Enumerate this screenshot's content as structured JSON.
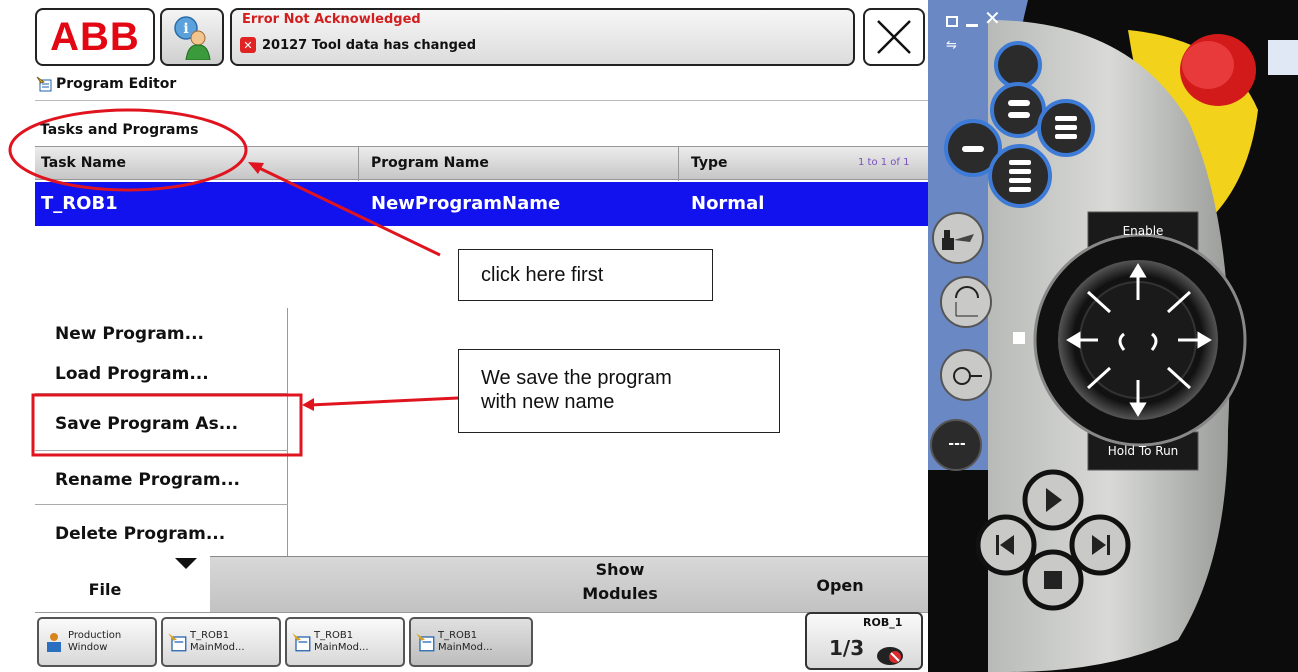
{
  "header": {
    "logo_text": "ABB",
    "status_title": "Error Not Acknowledged",
    "status_message": "20127 Tool data has changed",
    "close_symbol": "✕"
  },
  "editor": {
    "title": "Program Editor",
    "section_heading": "Tasks and Programs",
    "columns": [
      "Task Name",
      "Program Name",
      "Type"
    ],
    "page_count": "1 to 1 of 1",
    "rows": [
      {
        "task": "T_ROB1",
        "program": "NewProgramName",
        "type": "Normal"
      }
    ]
  },
  "file_menu": {
    "items": [
      "New Program...",
      "Load Program...",
      "Save Program As...",
      "Rename Program...",
      "Delete Program..."
    ]
  },
  "toolbar": {
    "file_label": "File",
    "show_modules_line1": "Show",
    "show_modules_line2": "Modules",
    "open_label": "Open"
  },
  "taskbar": {
    "items": [
      {
        "line1": "Production",
        "line2": "Window"
      },
      {
        "line1": "T_ROB1",
        "line2": "MainMod..."
      },
      {
        "line1": "T_ROB1",
        "line2": "MainMod..."
      },
      {
        "line1": "T_ROB1",
        "line2": "MainMod..."
      }
    ],
    "rob_label": "ROB_1",
    "rob_fraction": "1/3"
  },
  "annotations": {
    "callout1": "click here first",
    "callout2_line1": "We save the program",
    "callout2_line2": "with new name"
  },
  "pendant": {
    "enable_label": "Enable",
    "hold_label": "Hold To Run",
    "dash_label": "---"
  },
  "colors": {
    "selected_row": "#1212ee",
    "error_red": "#d21e1e",
    "annotation_red": "#e0141e",
    "logo_red": "#e30613"
  }
}
